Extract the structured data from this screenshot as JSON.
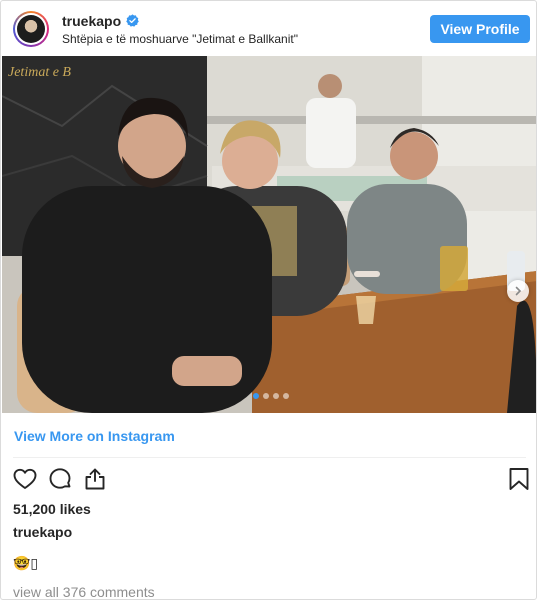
{
  "header": {
    "username": "truekapo",
    "verified_icon": "verified-badge-icon",
    "location": "Shtëpia e të moshuarve \"Jetimat e Ballkanit\"",
    "view_profile_label": "View Profile",
    "accent_color": "#3897f0"
  },
  "photo": {
    "wall_sign_text": "Jetimat e B",
    "carousel": {
      "total": 4,
      "active": 1
    },
    "next_icon": "chevron-right-icon"
  },
  "links": {
    "view_more": "View More on Instagram"
  },
  "actions": {
    "like_icon": "heart-icon",
    "comment_icon": "comment-bubble-icon",
    "share_icon": "share-icon",
    "save_icon": "bookmark-icon"
  },
  "stats": {
    "likes": "51,200 likes"
  },
  "caption": {
    "username": "truekapo",
    "text": "🤓▯"
  },
  "comments": {
    "label": "view all 376 comments"
  }
}
